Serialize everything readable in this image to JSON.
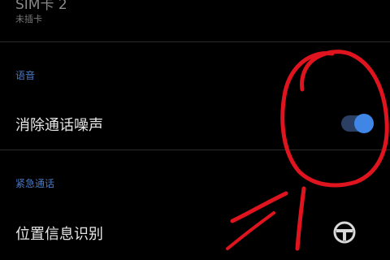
{
  "sim_card_2": {
    "title": "SIM卡 2",
    "status": "未插卡"
  },
  "section_voice": {
    "header": "语音",
    "noise_cancel": {
      "label": "消除通话噪声",
      "enabled": true
    }
  },
  "section_emergency": {
    "header": "紧急通话",
    "location_id": {
      "label": "位置信息识别"
    }
  },
  "colors": {
    "background": "#000000",
    "section_header": "#4a78c4",
    "toggle_on": "#3f86e6",
    "annotation": "#e0141e"
  },
  "icons": {
    "watermark": "watermark-logo-icon"
  }
}
